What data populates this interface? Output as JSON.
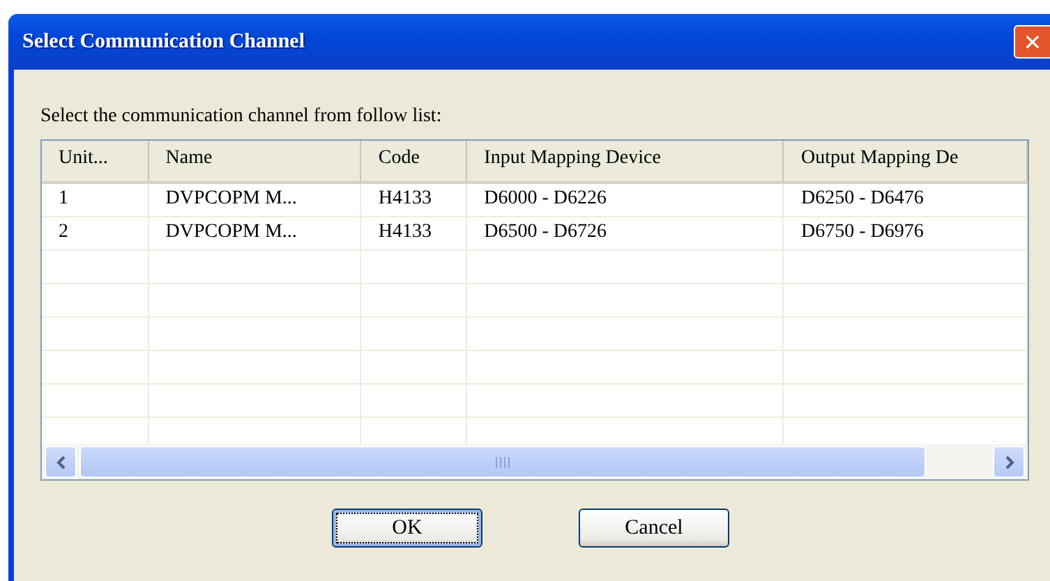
{
  "window": {
    "title": "Select Communication Channel",
    "close": "✕"
  },
  "prompt": "Select the communication channel from follow list:",
  "table": {
    "columns": [
      "Unit...",
      "Name",
      "Code",
      "Input Mapping Device",
      "Output Mapping De"
    ],
    "rows": [
      [
        "1",
        "DVPCOPM M...",
        "H4133",
        "D6000 - D6226",
        "D6250 - D6476"
      ],
      [
        "2",
        "DVPCOPM M...",
        "H4133",
        "D6500 - D6726",
        "D6750 - D6976"
      ]
    ]
  },
  "buttons": [
    {
      "label": "OK",
      "focused": true
    },
    {
      "label": "Cancel",
      "focused": false
    }
  ]
}
